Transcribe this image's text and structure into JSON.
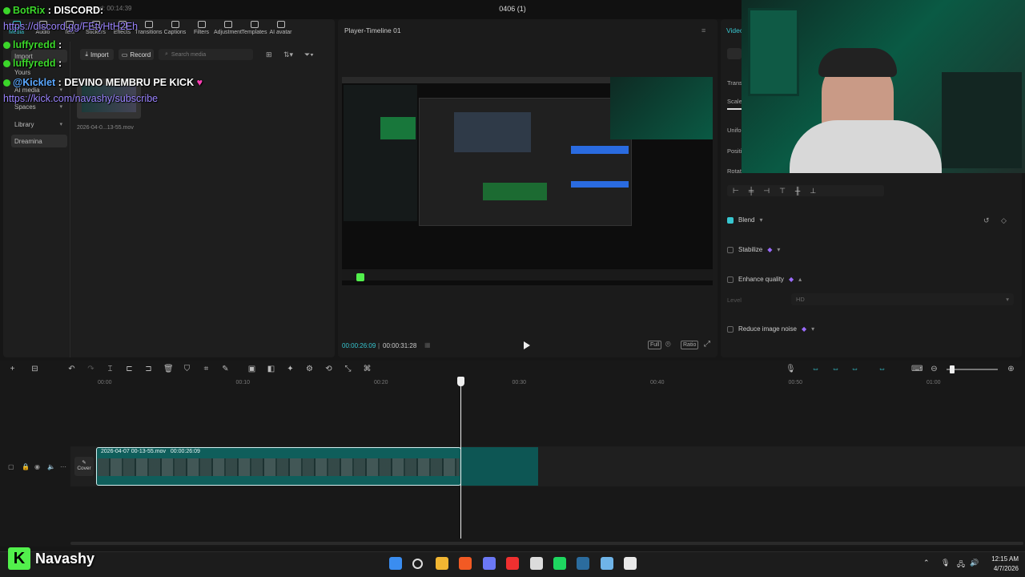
{
  "app": {
    "project_title": "0406 (1)",
    "autosave": "ed: 00:14:39"
  },
  "tool_tabs": [
    {
      "label": "Media",
      "icon": "media-icon",
      "active": true
    },
    {
      "label": "Audio",
      "icon": "audio-icon"
    },
    {
      "label": "Text",
      "icon": "text-icon"
    },
    {
      "label": "Stickers",
      "icon": "stickers-icon"
    },
    {
      "label": "Effects",
      "icon": "effects-icon"
    },
    {
      "label": "Transitions",
      "icon": "transitions-icon"
    },
    {
      "label": "Captions",
      "icon": "captions-icon"
    },
    {
      "label": "Filters",
      "icon": "filters-icon"
    },
    {
      "label": "Adjustment",
      "icon": "adjustment-icon"
    },
    {
      "label": "Templates",
      "icon": "templates-icon"
    },
    {
      "label": "AI avatar",
      "icon": "ai-avatar-icon"
    }
  ],
  "media_side": {
    "import": "Import",
    "yours": "Yours",
    "ai_media": "AI media",
    "spaces": "Spaces",
    "library": "Library",
    "dreamina": "Dreamina"
  },
  "media_toolbar": {
    "import_label": "Import",
    "record_label": "Record",
    "search_placeholder": "Search media"
  },
  "media_item": {
    "filename": "2026-04-0...13-55.mov"
  },
  "player": {
    "title": "Player-Timeline 01",
    "time_current": "00:00:26:09",
    "time_total": "00:00:31:28",
    "full_label": "Full",
    "ratio_label": "Ratio"
  },
  "right_panel": {
    "tab": "Video",
    "labels": {
      "transform": "Trans",
      "scale": "Scale",
      "uniform": "Unifo",
      "position": "Positi",
      "rotate": "Rotat"
    },
    "blend": "Blend",
    "stabilize": "Stabilize",
    "enhance_quality": "Enhance quality",
    "level_label": "Level",
    "level_value": "HD",
    "reduce_noise": "Reduce image noise",
    "blend_checked": true
  },
  "timeline": {
    "ruler": [
      "00:00",
      "00:10",
      "00:20",
      "00:30",
      "00:40",
      "00:50",
      "01:00"
    ],
    "clip_label": "2026-04-07 00-13-55.mov",
    "clip_duration": "00:00:26:09",
    "cover_label": "Cover",
    "zoom_level": 0.1
  },
  "taskbar": {
    "time": "12:15 AM",
    "date": "4/7/2026",
    "apps": [
      "windows-start-icon",
      "search-icon",
      "file-explorer-icon",
      "brave-icon",
      "discord-icon",
      "youtube-icon",
      "chrome-icon",
      "spotify-icon",
      "steam-icon",
      "notepad-icon",
      "capcut-icon"
    ]
  },
  "overlay": {
    "chat": [
      {
        "name": "BotRix",
        "sep": " : ",
        "text": "DISCORD:"
      },
      {
        "name": "",
        "sep": "",
        "text": "https://discord.gg/FEtyHtH2Eh",
        "link": true
      },
      {
        "name": "luffyredd",
        "sep": " : ",
        "text": ""
      },
      {
        "name": "luffyredd",
        "sep": " : ",
        "text": ""
      },
      {
        "name": "@Kicklet",
        "sep": " : ",
        "text": "DEVINO MEMBRU PE KICK"
      },
      {
        "name": "",
        "sep": "",
        "text": "https://kick.com/navashy/subscribe",
        "link": true
      }
    ],
    "brand_letter": "K",
    "brand_name": "Navashy",
    "accent": "#37c6d0",
    "chat_name_color": "#3bd62a",
    "link_color": "#9b84ff"
  }
}
